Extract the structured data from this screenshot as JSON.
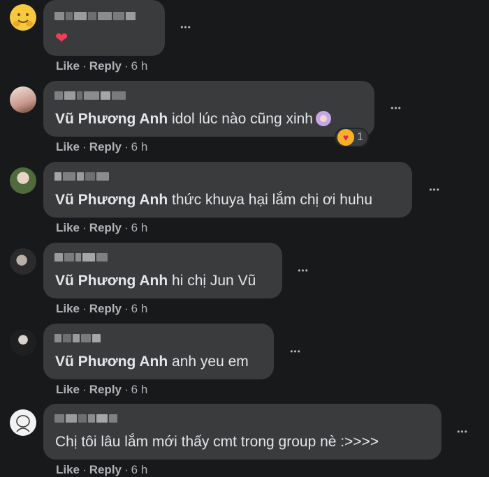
{
  "comments": [
    {
      "has_heart": true,
      "heart": "❤",
      "author_blurred": true,
      "body_name": "",
      "body_text": "",
      "time": "6 h"
    },
    {
      "author_blurred": true,
      "body_name": "Vũ Phương Anh",
      "body_text": "idol lúc nào cũng xinh",
      "reaction_count": "1",
      "time": "6 h"
    },
    {
      "author_blurred": true,
      "body_name": "Vũ Phương Anh",
      "body_text": "thức khuya hại lắm chị ơi huhu",
      "time": "6 h"
    },
    {
      "author_blurred": true,
      "body_name": "Vũ Phương Anh",
      "body_text": "hi chị Jun Vũ",
      "time": "6 h"
    },
    {
      "author_blurred": true,
      "body_name": "Vũ Phương Anh",
      "body_text": "anh yeu em",
      "time": "6 h"
    },
    {
      "author_blurred": true,
      "body_name": "",
      "body_text": "Chị tôi lâu lắm mới thấy cmt trong group nè :>>>>",
      "time": "6 h"
    }
  ],
  "labels": {
    "like": "Like",
    "reply": "Reply",
    "sep": "·",
    "more": "•••"
  },
  "colors": {
    "background": "#18191a",
    "bubble": "#3a3b3c",
    "text": "#e4e6eb",
    "muted": "#b0b3b8"
  }
}
